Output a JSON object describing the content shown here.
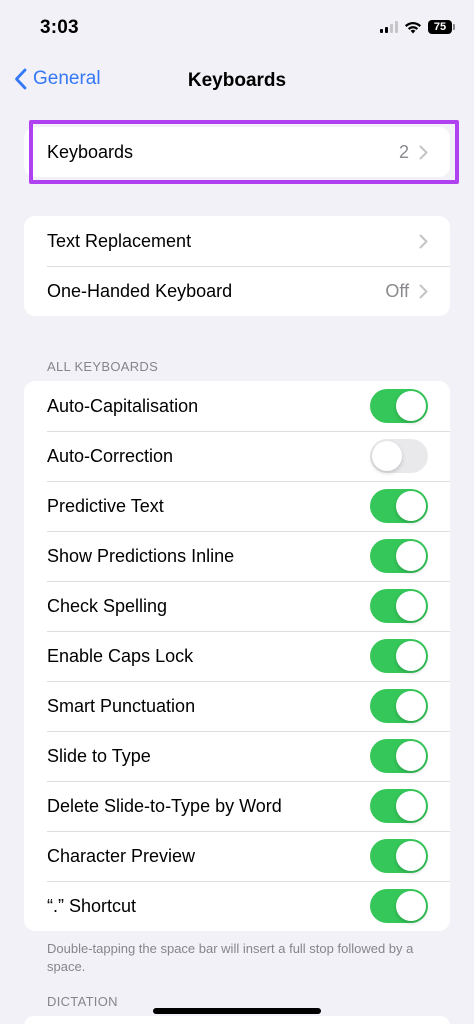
{
  "status_bar": {
    "time": "3:03",
    "battery": "75"
  },
  "nav": {
    "back_label": "General",
    "title": "Keyboards"
  },
  "keyboards_group": {
    "label": "Keyboards",
    "value": "2"
  },
  "text_group": [
    {
      "label": "Text Replacement",
      "value": ""
    },
    {
      "label": "One-Handed Keyboard",
      "value": "Off"
    }
  ],
  "all_keyboards": {
    "header": "ALL KEYBOARDS",
    "items": [
      {
        "label": "Auto-Capitalisation",
        "on": true
      },
      {
        "label": "Auto-Correction",
        "on": false
      },
      {
        "label": "Predictive Text",
        "on": true
      },
      {
        "label": "Show Predictions Inline",
        "on": true
      },
      {
        "label": "Check Spelling",
        "on": true
      },
      {
        "label": "Enable Caps Lock",
        "on": true
      },
      {
        "label": "Smart Punctuation",
        "on": true
      },
      {
        "label": "Slide to Type",
        "on": true
      },
      {
        "label": "Delete Slide-to-Type by Word",
        "on": true
      },
      {
        "label": "Character Preview",
        "on": true
      },
      {
        "label": "“.” Shortcut",
        "on": true
      }
    ],
    "footer": "Double-tapping the space bar will insert a full stop followed by a space."
  },
  "dictation": {
    "header": "DICTATION"
  },
  "colors": {
    "accent": "#3478f6",
    "toggle_on": "#35c759",
    "toggle_off": "#e9e9eb",
    "highlight": "#b041f0",
    "background": "#f2f1f7"
  }
}
